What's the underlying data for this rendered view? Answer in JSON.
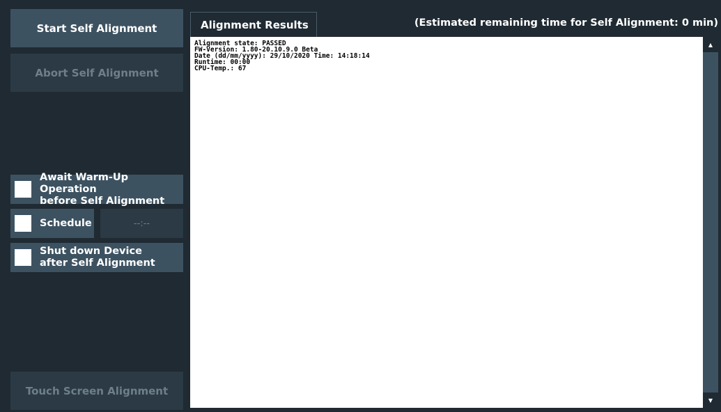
{
  "left_panel": {
    "start_button": "Start Self Alignment",
    "abort_button": "Abort Self Alignment",
    "await_warmup_label": "Await Warm-Up Operation\nbefore Self Alignment",
    "schedule_label": "Schedule",
    "schedule_time": "--:--",
    "shutdown_label": "Shut down Device\nafter Self Alignment",
    "touch_button": "Touch Screen Alignment"
  },
  "results": {
    "tab_label": "Alignment Results",
    "estimate_text": "(Estimated remaining time for Self Alignment: 0 min)",
    "lines": [
      "Alignment state: PASSED",
      "FW-Version: 1.80-20.10.9.0 Beta",
      "Date (dd/mm/yyyy): 29/10/2020 Time: 14:18:14",
      "Runtime: 00:00",
      "CPU-Temp.: 67"
    ]
  },
  "scrollbar": {
    "up_icon": "▲",
    "down_icon": "▼"
  },
  "colors": {
    "background": "#1f2a32",
    "button": "#3d5261",
    "button_disabled": "#2b3a45",
    "disabled_text": "#6f7f8a"
  }
}
